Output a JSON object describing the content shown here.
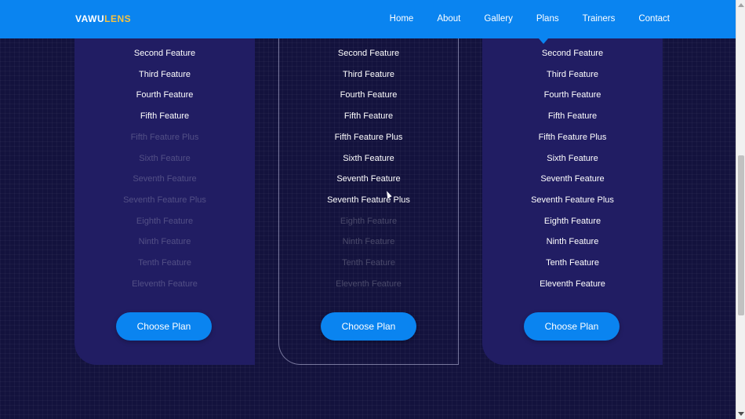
{
  "brand": {
    "part1": "VAWU",
    "part2": "LENS",
    "accent_color": "#f5c242"
  },
  "nav": {
    "items": [
      "Home",
      "About",
      "Gallery",
      "Plans",
      "Trainers",
      "Contact"
    ],
    "active": "Plans",
    "background_color": "#0a84f0"
  },
  "plans": [
    {
      "features": [
        {
          "label": "Second Feature",
          "included": true
        },
        {
          "label": "Third Feature",
          "included": true
        },
        {
          "label": "Fourth Feature",
          "included": true
        },
        {
          "label": "Fifth Feature",
          "included": true
        },
        {
          "label": "Fifth Feature Plus",
          "included": false
        },
        {
          "label": "Sixth Feature",
          "included": false
        },
        {
          "label": "Seventh Feature",
          "included": false
        },
        {
          "label": "Seventh Feature Plus",
          "included": false
        },
        {
          "label": "Eighth Feature",
          "included": false
        },
        {
          "label": "Ninth Feature",
          "included": false
        },
        {
          "label": "Tenth Feature",
          "included": false
        },
        {
          "label": "Eleventh Feature",
          "included": false
        }
      ],
      "button_label": "Choose Plan"
    },
    {
      "features": [
        {
          "label": "Second Feature",
          "included": true
        },
        {
          "label": "Third Feature",
          "included": true
        },
        {
          "label": "Fourth Feature",
          "included": true
        },
        {
          "label": "Fifth Feature",
          "included": true
        },
        {
          "label": "Fifth Feature Plus",
          "included": true
        },
        {
          "label": "Sixth Feature",
          "included": true
        },
        {
          "label": "Seventh Feature",
          "included": true
        },
        {
          "label": "Seventh Feature Plus",
          "included": true
        },
        {
          "label": "Eighth Feature",
          "included": false
        },
        {
          "label": "Ninth Feature",
          "included": false
        },
        {
          "label": "Tenth Feature",
          "included": false
        },
        {
          "label": "Eleventh Feature",
          "included": false
        }
      ],
      "button_label": "Choose Plan"
    },
    {
      "features": [
        {
          "label": "Second Feature",
          "included": true
        },
        {
          "label": "Third Feature",
          "included": true
        },
        {
          "label": "Fourth Feature",
          "included": true
        },
        {
          "label": "Fifth Feature",
          "included": true
        },
        {
          "label": "Fifth Feature Plus",
          "included": true
        },
        {
          "label": "Sixth Feature",
          "included": true
        },
        {
          "label": "Seventh Feature",
          "included": true
        },
        {
          "label": "Seventh Feature Plus",
          "included": true
        },
        {
          "label": "Eighth Feature",
          "included": true
        },
        {
          "label": "Ninth Feature",
          "included": true
        },
        {
          "label": "Tenth Feature",
          "included": true
        },
        {
          "label": "Eleventh Feature",
          "included": true
        }
      ],
      "button_label": "Choose Plan"
    }
  ],
  "colors": {
    "page_background": "#13123d",
    "card_background": "#211d63",
    "button": "#0a84f0"
  }
}
